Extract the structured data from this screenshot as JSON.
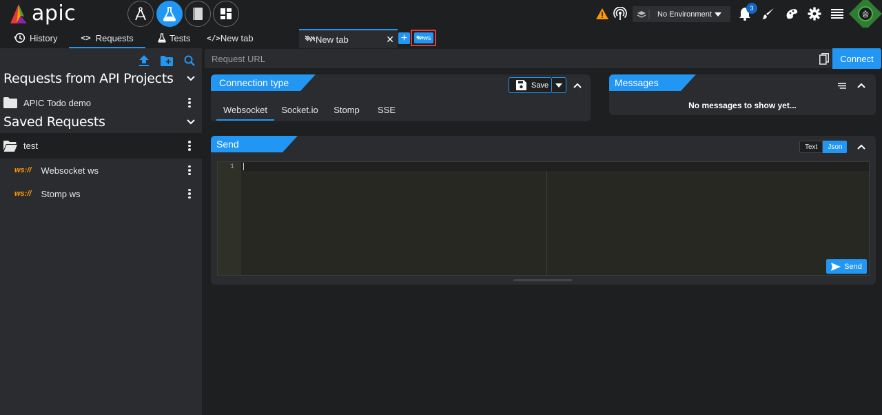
{
  "app": {
    "logo_text": "apic"
  },
  "topbar": {
    "modules": [
      "designer-icon",
      "tester-icon",
      "docs-icon",
      "dashboard-icon"
    ],
    "environment_label": "No Environment",
    "notification_count": "3",
    "avatar_text": "승"
  },
  "nav_tabs": [
    {
      "label": "History"
    },
    {
      "label": "Requests"
    },
    {
      "label": "Tests"
    },
    {
      "label": "New tab"
    }
  ],
  "open_tabs": [
    {
      "label": "New tab"
    }
  ],
  "ws_button_label": "ws",
  "sidebar": {
    "section_api_projects": "Requests from API Projects",
    "project_item": "APIC Todo demo",
    "section_saved": "Saved Requests",
    "folder": "test",
    "requests": [
      {
        "method": "ws://",
        "name": "Websocket ws"
      },
      {
        "method": "ws://",
        "name": "Stomp ws"
      }
    ]
  },
  "request": {
    "url_placeholder": "Request URL",
    "connect_label": "Connect"
  },
  "connection_panel": {
    "title": "Connection type",
    "save_label": "Save",
    "types": [
      "Websocket",
      "Socket.io",
      "Stomp",
      "SSE"
    ]
  },
  "messages_panel": {
    "title": "Messages",
    "empty_text": "No messages to show yet..."
  },
  "send_panel": {
    "title": "Send",
    "format_options": [
      "Text",
      "Json"
    ],
    "line_number": "1",
    "send_label": "Send"
  },
  "colors": {
    "accent": "#2196f3",
    "background": "#1e1f21",
    "panel": "#2b2c2f",
    "ws_tag": "#ff9800",
    "highlight_border": "#e53935"
  }
}
